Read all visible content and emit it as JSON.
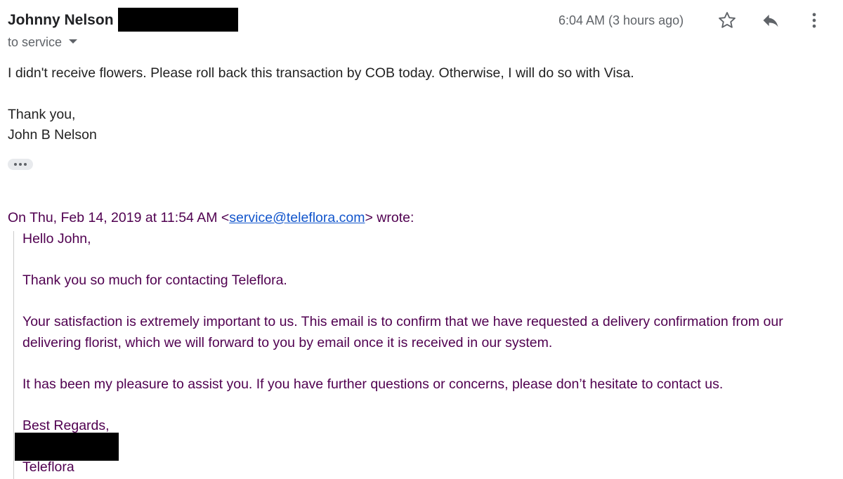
{
  "header": {
    "sender_name": "Johnny Nelson",
    "recipient": "to service",
    "timestamp": "6:04 AM (3 hours ago)"
  },
  "actions": {
    "star_icon": "star-outline-icon",
    "reply_icon": "reply-icon",
    "more_icon": "more-vert-icon"
  },
  "message": {
    "line1": "I didn't receive flowers. Please roll back this transaction by COB today. Otherwise, I will do so with Visa.",
    "line2": "Thank you,",
    "line3": "John B Nelson"
  },
  "quoted": {
    "header_prefix": "On Thu, Feb 14, 2019 at 11:54 AM <",
    "email": "service@teleflora.com",
    "header_suffix": "> wrote:",
    "lines": [
      "Hello John,",
      "Thank you so much for contacting Teleflora.",
      "Your satisfaction is extremely important to us. This email is to confirm that we have requested a delivery confirmation from our",
      "delivering florist, which we will forward to you by email once it is received in our system.",
      "It has been my pleasure to assist you. If you have further questions or concerns, please don’t hesitate to contact us.",
      "Best Regards,",
      "Teleflora"
    ]
  },
  "colors": {
    "quoted_text": "#500050",
    "link": "#1155cc",
    "secondary": "#5f6368",
    "redaction": "#000000"
  }
}
